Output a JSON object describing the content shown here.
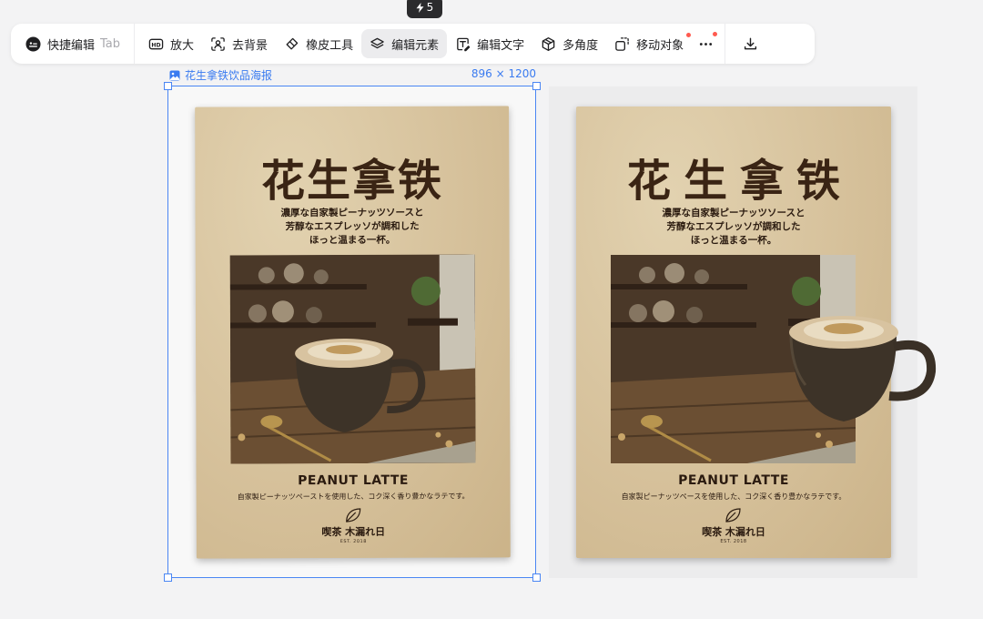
{
  "credit": {
    "count": "5"
  },
  "toolbar": {
    "quick_edit": "快捷编辑",
    "quick_edit_hint": "Tab",
    "upscale": "放大",
    "remove_bg": "去背景",
    "eraser": "橡皮工具",
    "edit_elements": "编辑元素",
    "edit_text": "编辑文字",
    "multi_angle": "多角度",
    "move_object": "移动对象"
  },
  "selection": {
    "name": "花生拿铁饮品海报",
    "size": "896 × 1200"
  },
  "poster": {
    "title": "花生拿铁",
    "subtitle_line1": "濃厚な自家製ピーナッツソースと",
    "subtitle_line2": "芳醇なエスプレッソが調和した",
    "subtitle_line3": "ほっと温まる一杯。",
    "product_name": "PEANUT LATTE",
    "description_1": "自家製ピーナッツペーストを使用した、コク深く香り豊かなラテです。",
    "description_2": "自家製ピーナッツペースを使用した、コク深く香り豊かなラテです。",
    "shop_name": "喫茶 木漏れ日",
    "est": "EST. 2018"
  },
  "colors": {
    "accent": "#4a86f3",
    "notification_dot": "#ff5a4f",
    "poster_paper": "#d9c5a0",
    "poster_ink": "#3a2414"
  }
}
